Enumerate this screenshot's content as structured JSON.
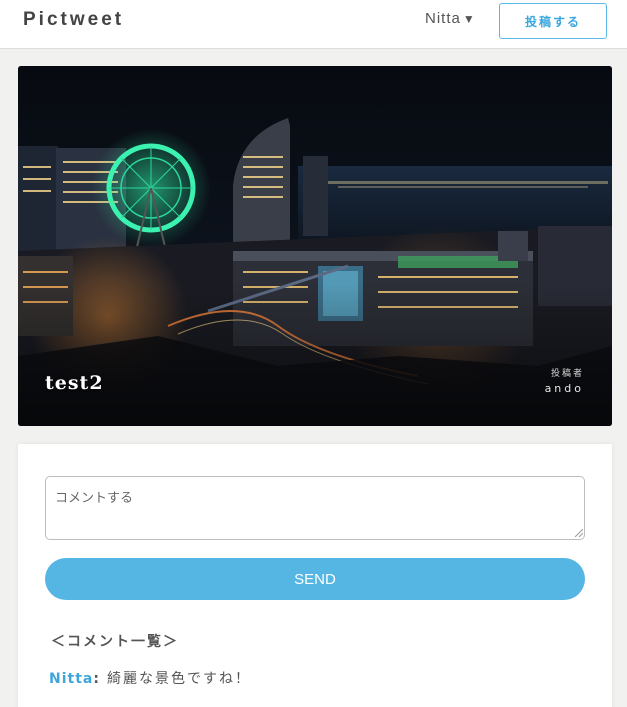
{
  "header": {
    "logo": "Pictweet",
    "user_name": "Nitta",
    "user_caret": "▼",
    "post_button": "投稿する"
  },
  "tweet": {
    "title": "test2",
    "poster_label": "投稿者",
    "poster_name": "ando"
  },
  "comment_form": {
    "placeholder": "コメントする",
    "value": "",
    "send_label": "SEND"
  },
  "comments": {
    "heading": "＜コメント一覧＞",
    "items": [
      {
        "author": "Nitta",
        "separator": ":",
        "text": "綺麗な景色ですね！"
      }
    ]
  },
  "colors": {
    "accent": "#55b6e4",
    "accent_text": "#3aa7de",
    "page_bg": "#f1f1ef"
  }
}
